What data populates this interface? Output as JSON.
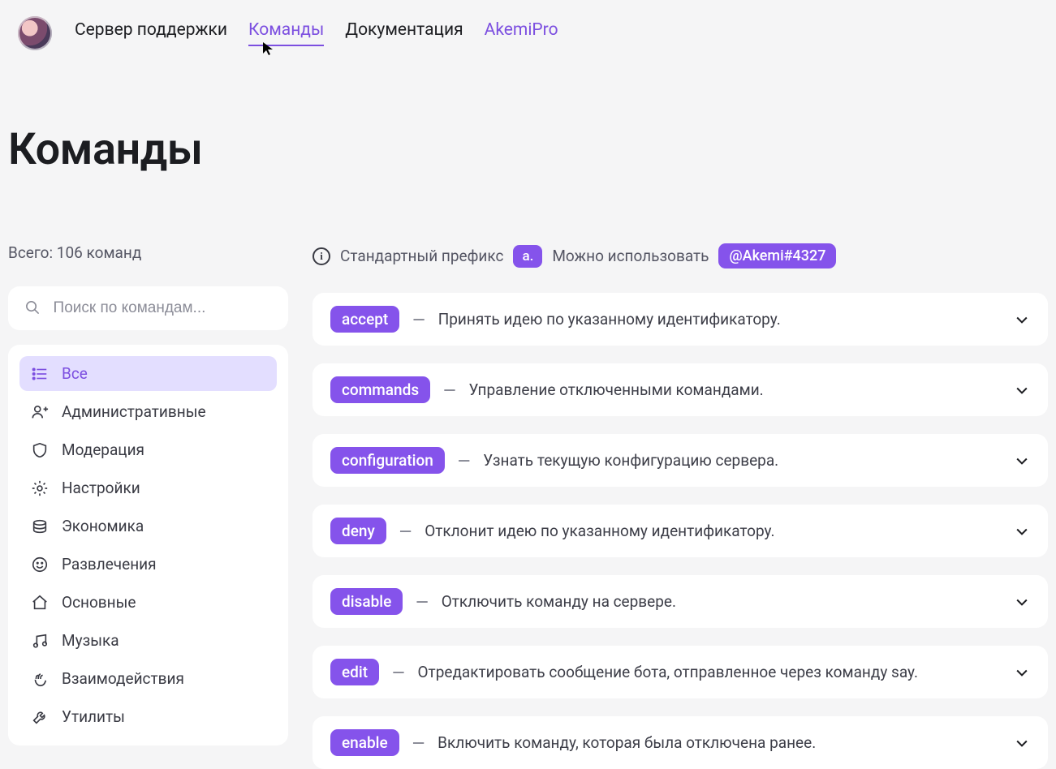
{
  "nav": {
    "items": [
      {
        "label": "Сервер поддержки",
        "active": false,
        "premium": false
      },
      {
        "label": "Команды",
        "active": true,
        "premium": false
      },
      {
        "label": "Документация",
        "active": false,
        "premium": false
      },
      {
        "label": "AkemiPro",
        "active": false,
        "premium": true
      }
    ]
  },
  "page": {
    "title": "Команды",
    "total_label": "Всего: 106 команд"
  },
  "info": {
    "prefix_label": "Стандартный префикс",
    "prefix_value": "a.",
    "can_use_label": "Можно использовать",
    "mention_tag": "@Akemi#4327"
  },
  "search": {
    "placeholder": "Поиск по командам..."
  },
  "sidebar": {
    "items": [
      {
        "icon": "list",
        "label": "Все",
        "active": true
      },
      {
        "icon": "admin",
        "label": "Административные",
        "active": false
      },
      {
        "icon": "shield",
        "label": "Модерация",
        "active": false
      },
      {
        "icon": "gear",
        "label": "Настройки",
        "active": false
      },
      {
        "icon": "economy",
        "label": "Экономика",
        "active": false
      },
      {
        "icon": "smile",
        "label": "Развлечения",
        "active": false
      },
      {
        "icon": "home",
        "label": "Основные",
        "active": false
      },
      {
        "icon": "music",
        "label": "Музыка",
        "active": false
      },
      {
        "icon": "interact",
        "label": "Взаимодействия",
        "active": false
      },
      {
        "icon": "wrench",
        "label": "Утилиты",
        "active": false
      }
    ]
  },
  "commands": [
    {
      "name": "accept",
      "desc": "Принять идею по указанному идентификатору."
    },
    {
      "name": "commands",
      "desc": "Управление отключенными командами."
    },
    {
      "name": "configuration",
      "desc": "Узнать текущую конфигурацию сервера."
    },
    {
      "name": "deny",
      "desc": "Отклонит идею по указанному идентификатору."
    },
    {
      "name": "disable",
      "desc": "Отключить команду на сервере."
    },
    {
      "name": "edit",
      "desc": "Отредактировать сообщение бота, отправленное через команду say."
    },
    {
      "name": "enable",
      "desc": "Включить команду, которая была отключена ранее."
    }
  ],
  "dash": "—"
}
